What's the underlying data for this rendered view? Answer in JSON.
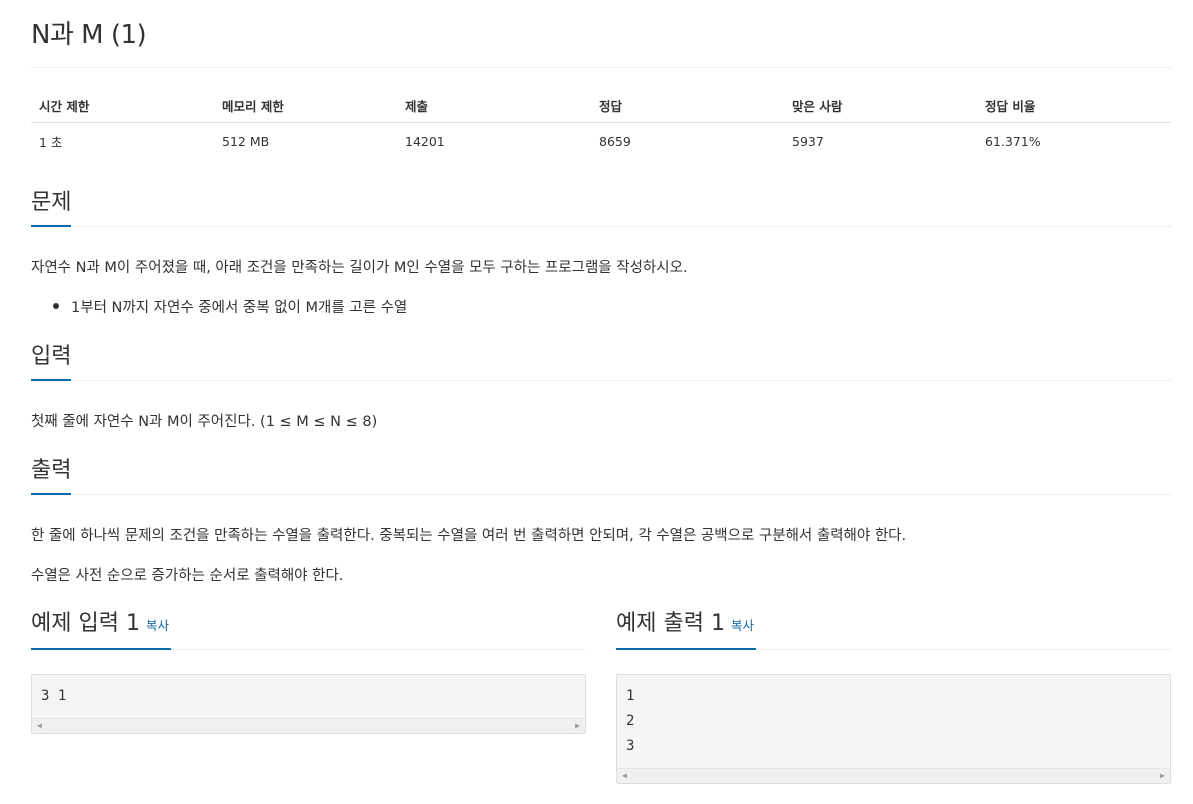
{
  "title": "N과 M (1)",
  "info_table": {
    "headers": [
      "시간 제한",
      "메모리 제한",
      "제출",
      "정답",
      "맞은 사람",
      "정답 비율"
    ],
    "values": [
      "1 초",
      "512 MB",
      "14201",
      "8659",
      "5937",
      "61.371%"
    ]
  },
  "problem": {
    "heading": "문제",
    "text": "자연수 N과 M이 주어졌을 때, 아래 조건을 만족하는 길이가 M인 수열을 모두 구하는 프로그램을 작성하시오.",
    "bullets": [
      "1부터 N까지 자연수 중에서 중복 없이 M개를 고른 수열"
    ]
  },
  "input": {
    "heading": "입력",
    "text": "첫째 줄에 자연수 N과 M이 주어진다. (1 ≤ M ≤ N ≤ 8)"
  },
  "output": {
    "heading": "출력",
    "paragraphs": [
      "한 줄에 하나씩 문제의 조건을 만족하는 수열을 출력한다. 중복되는 수열을 여러 번 출력하면 안되며, 각 수열은 공백으로 구분해서 출력해야 한다.",
      "수열은 사전 순으로 증가하는 순서로 출력해야 한다."
    ]
  },
  "sample_input": {
    "heading": "예제 입력 1",
    "copy_label": "복사",
    "lines": [
      "3 1"
    ]
  },
  "sample_output": {
    "heading": "예제 출력 1",
    "copy_label": "복사",
    "lines": [
      "1",
      "2",
      "3"
    ]
  },
  "icons": {
    "scroll_left": "scroll-left-arrow-icon",
    "scroll_right": "scroll-right-arrow-icon"
  },
  "colors": {
    "accent": "#0d6aa8",
    "text": "#333333",
    "code_bg": "#f5f5f5"
  }
}
